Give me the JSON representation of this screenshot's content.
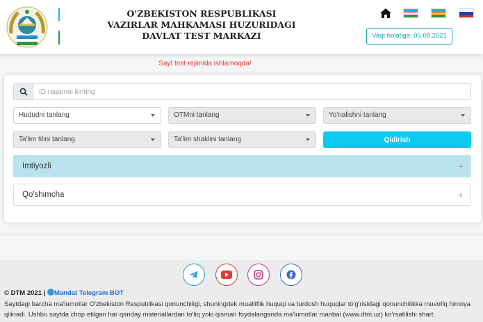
{
  "header": {
    "title_line1": "O'ZBEKISTON RESPUBLIKASI",
    "title_line2": "VAZIRLAR MAHKAMASI HUZURIDAGI",
    "title_line3": "DAVLAT TEST MARKAZI",
    "date_label": "Vaqt holatiga: 05.08.2021",
    "nav": [
      "home-icon",
      "flag-uz",
      "flag-karakalpak",
      "flag-ru"
    ]
  },
  "notice": "Sayt test rejimida ishlamoqda!",
  "search": {
    "placeholder": "ID raqamni kiriting",
    "icon": "search-icon"
  },
  "filters": {
    "region": "Hududni tanlang",
    "university": "OTMni tanlang",
    "direction": "Yo'nalishni tanlang",
    "language": "Ta'lim tilini tanlang",
    "form": "Ta'lim shaklini tanlang",
    "submit": "Qidirish"
  },
  "accordion": {
    "item1": "Imtiyozli",
    "item2": "Qo'shimcha"
  },
  "footer": {
    "copyright": "© DTM 2021 |",
    "telegram_link": "Mandat Telegram BOT",
    "disclaimer": "Saytdagi barcha ma'lumotlar O'zbekiston Respublikasi qonunchiligi, shuningdek mualliflik huquqi va turdosh huquqlar to'g'risidagi qonunchilikka muvofiq himoya qilinadi. Ushbu saytda chop etilgan har qanday materiallardan to'liq yoki qisman foydalanganda ma'lumotlar manbai (www.dtm.uz) ko'rsatilishi shart.",
    "social": [
      "telegram-icon",
      "youtube-icon",
      "instagram-icon",
      "facebook-icon"
    ]
  },
  "colors": {
    "accent": "#0dcaf0",
    "accordion_active": "#b8e3ec",
    "notice": "#e53935",
    "telegram": "#2a9fd6",
    "youtube": "#e53935",
    "instagram": "#c13584",
    "facebook": "#3b69c6"
  }
}
